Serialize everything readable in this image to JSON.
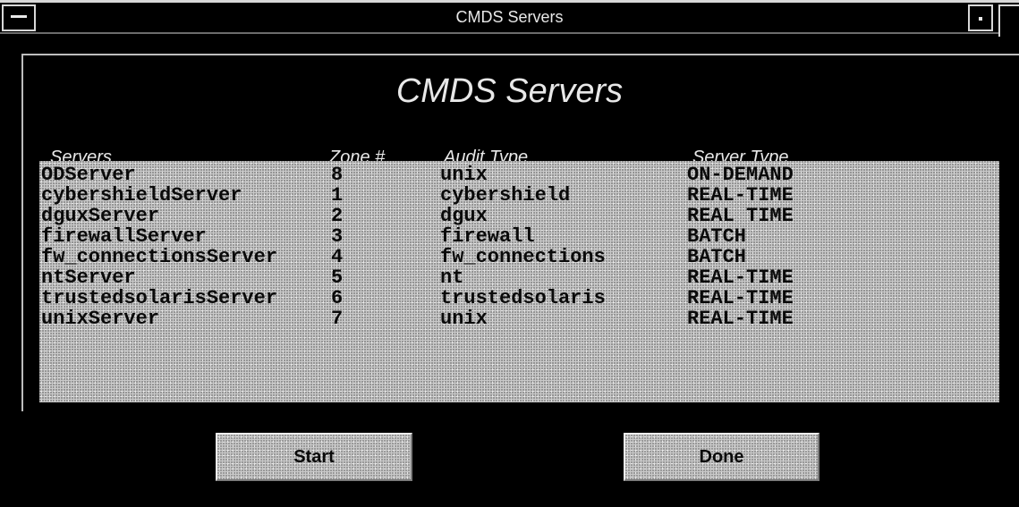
{
  "window": {
    "title": "CMDS Servers"
  },
  "main": {
    "heading": "CMDS Servers",
    "columns": {
      "servers": "Servers",
      "zone": "Zone #",
      "audit_type": "Audit Type",
      "server_type": "Server Type"
    },
    "rows": [
      {
        "server": "ODServer",
        "zone": "8",
        "audit_type": "unix",
        "server_type": "ON-DEMAND"
      },
      {
        "server": "cybershieldServer",
        "zone": "1",
        "audit_type": "cybershield",
        "server_type": "REAL-TIME"
      },
      {
        "server": "dguxServer",
        "zone": "2",
        "audit_type": "dgux",
        "server_type": "REAL TIME"
      },
      {
        "server": "firewallServer",
        "zone": "3",
        "audit_type": "firewall",
        "server_type": "BATCH"
      },
      {
        "server": "fw_connectionsServer",
        "zone": "4",
        "audit_type": "fw_connections",
        "server_type": "BATCH"
      },
      {
        "server": "ntServer",
        "zone": "5",
        "audit_type": "nt",
        "server_type": "REAL-TIME"
      },
      {
        "server": "trustedsolarisServer",
        "zone": "6",
        "audit_type": "trustedsolaris",
        "server_type": "REAL-TIME"
      },
      {
        "server": "unixServer",
        "zone": "7",
        "audit_type": "unix",
        "server_type": "REAL-TIME"
      }
    ]
  },
  "buttons": {
    "start": "Start",
    "done": "Done"
  },
  "colors": {
    "window_bg": "#000000",
    "list_bg": "#c9c9c9",
    "button_bg": "#c8c8c8",
    "text_light": "#e8e8e8"
  },
  "icons": {
    "window_menu": "window-menu-icon",
    "minimize": "minimize-icon",
    "maximize": "maximize-icon"
  }
}
